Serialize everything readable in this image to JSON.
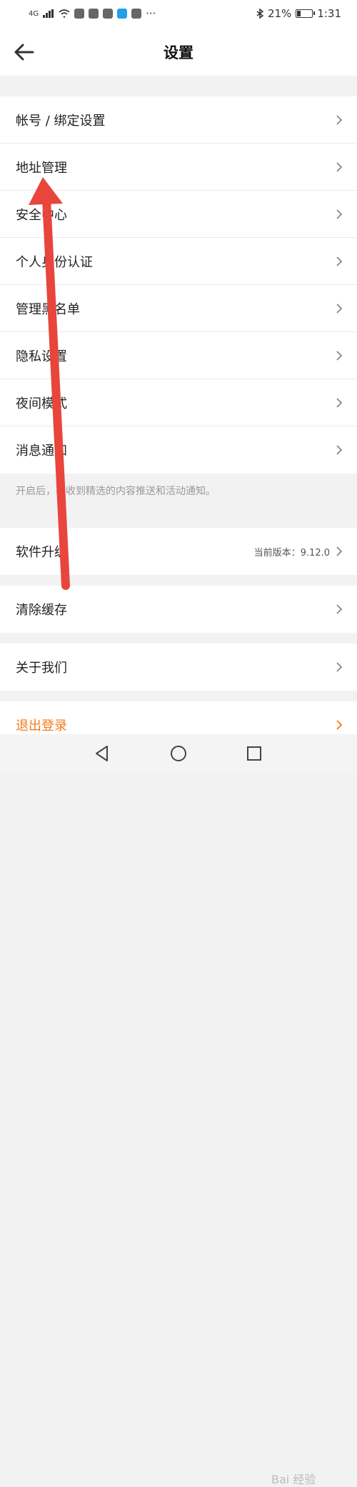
{
  "status_bar": {
    "network": "4G",
    "battery_text": "21%",
    "battery_level": 0.21,
    "time": "1:31",
    "more": "···"
  },
  "header": {
    "title": "设置",
    "back_icon": "arrow-left-icon"
  },
  "menu": [
    {
      "label": "帐号 / 绑定设置"
    },
    {
      "label": "地址管理"
    },
    {
      "label": "安全中心"
    },
    {
      "label": "个人身份认证"
    },
    {
      "label": "管理黑名单"
    },
    {
      "label": "隐私设置"
    },
    {
      "label": "夜间模式"
    },
    {
      "label": "消息通知"
    }
  ],
  "notification_hint": "开启后，将收到精选的内容推送和活动通知。",
  "upgrade": {
    "label": "软件升级",
    "version": "当前版本：9.12.0"
  },
  "cache": {
    "label": "清除缓存"
  },
  "about": {
    "label": "关于我们"
  },
  "logout": {
    "label": "退出登录",
    "color": "#f07b1e"
  },
  "annotation": {
    "color": "#e8453c"
  },
  "watermark": "Bai 经验"
}
